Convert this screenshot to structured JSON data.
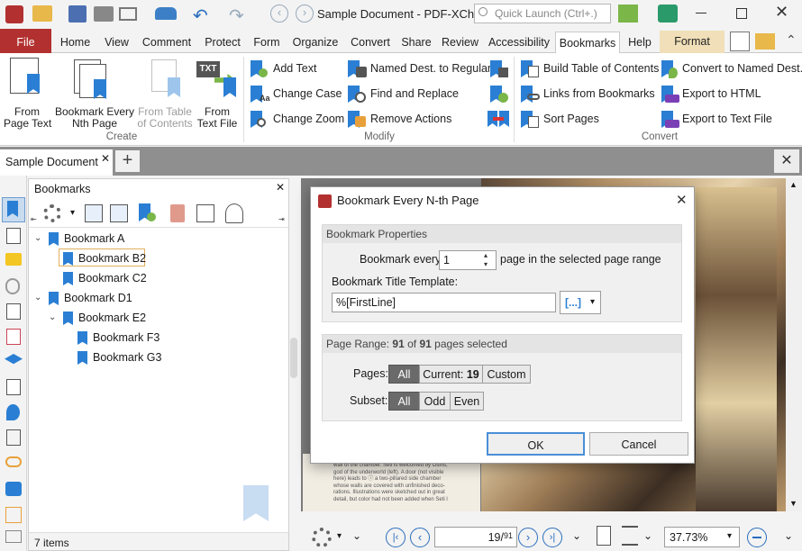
{
  "window": {
    "title": "Sample Document - PDF-XCha...",
    "search_placeholder": "Quick Launch (Ctrl+.)"
  },
  "tabs": [
    "File",
    "Home",
    "View",
    "Comment",
    "Protect",
    "Form",
    "Organize",
    "Convert",
    "Share",
    "Review",
    "Accessibility",
    "Bookmarks",
    "Help",
    "Format"
  ],
  "ribbon": {
    "create_group": "Create",
    "modify_group": "Modify",
    "convert_group": "Convert",
    "from_page_text_1": "From",
    "from_page_text_2": "Page Text",
    "every_nth_1": "Bookmark Every",
    "every_nth_2": "Nth Page",
    "from_toc_1": "From Table",
    "from_toc_2": "of Contents",
    "from_text_file_1": "From",
    "from_text_file_2": "Text File",
    "add_text": "Add Text",
    "change_case": "Change Case",
    "change_zoom": "Change Zoom",
    "named_dest_to_regular": "Named Dest. to Regular",
    "find_replace": "Find and Replace",
    "remove_actions": "Remove Actions",
    "build_toc": "Build Table of Contents",
    "links_from_bookmarks": "Links from Bookmarks",
    "sort_pages": "Sort Pages",
    "convert_to_named": "Convert to Named Dest.",
    "export_html": "Export to HTML",
    "export_text": "Export to Text File",
    "icon_colors": {
      "primary": "#2a7fd4",
      "accent": "#7ab648",
      "warn": "#e8a13a"
    }
  },
  "document_tab": "Sample Document",
  "bookmarks": {
    "title": "Bookmarks",
    "items": [
      {
        "label": "Bookmark A",
        "level": 0
      },
      {
        "label": "Bookmark B2",
        "level": 1
      },
      {
        "label": "Bookmark C2",
        "level": 1
      },
      {
        "label": "Bookmark D1",
        "level": 0
      },
      {
        "label": "Bookmark E2",
        "level": 1
      },
      {
        "label": "Bookmark F3",
        "level": 2
      },
      {
        "label": "Bookmark G3",
        "level": 2
      }
    ],
    "status": "7 items"
  },
  "page_text": [
    "wall of the chamber. Seti is welcomed by Osiris,",
    "god of the underworld (left). A door (not visible",
    "here) leads to ⓘ a two-pillared side chamber",
    "whose walls are covered with unfinished deco-",
    "rations. Illustrations were sketched out in great",
    "detail, but color had not been added when Seti l"
  ],
  "dialog": {
    "title": "Bookmark Every N-th Page",
    "props_header": "Bookmark Properties",
    "every_label": "Bookmark every",
    "every_value": "1",
    "every_suffix": "page in the selected page range",
    "template_label": "Bookmark Title Template:",
    "template_value": "%[FirstLine]",
    "macro_btn": "[...]",
    "range_prefix": "Page Range:",
    "range_selected": "91",
    "range_of": "of",
    "range_total": "91",
    "range_suffix": "pages selected",
    "pages_label": "Pages:",
    "pages_all": "All",
    "pages_current": "Current:",
    "pages_current_num": "19",
    "pages_custom": "Custom",
    "subset_label": "Subset:",
    "subset_all": "All",
    "subset_odd": "Odd",
    "subset_even": "Even",
    "ok": "OK",
    "cancel": "Cancel"
  },
  "status": {
    "page_current": "19",
    "page_total": "91",
    "zoom": "37.73%"
  }
}
